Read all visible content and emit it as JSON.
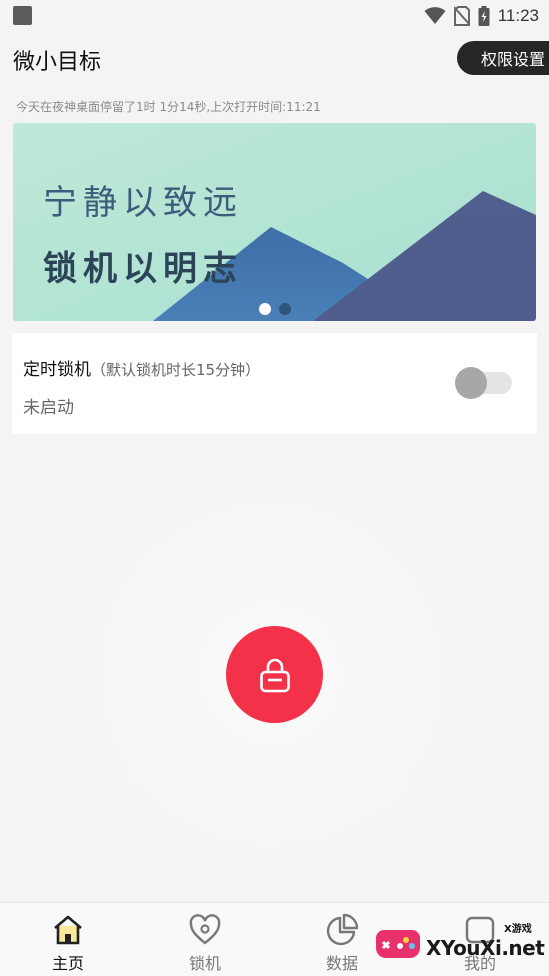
{
  "status_bar": {
    "time": "11:23",
    "icons": [
      "app-notification-icon",
      "wifi-icon",
      "no-sim-icon",
      "battery-charging-icon"
    ]
  },
  "header": {
    "title": "微小目标",
    "permission_button": "权限设置"
  },
  "usage_info": "今天在夜神桌面停留了1时 1分14秒,上次打开时间:11:21",
  "banner": {
    "line1": "宁静以致远",
    "line2": "锁机以明志",
    "slide_count": 2,
    "active_slide": 1
  },
  "timed_lock": {
    "title": "定时锁机",
    "note": "（默认锁机时长15分钟）",
    "status": "未启动",
    "enabled": false
  },
  "lock_button": {
    "icon": "padlock-icon",
    "color": "#f3324a"
  },
  "nav": {
    "items": [
      {
        "label": "主页",
        "icon": "home-icon",
        "active": true
      },
      {
        "label": "锁机",
        "icon": "heart-lock-icon",
        "active": false
      },
      {
        "label": "数据",
        "icon": "pie-chart-icon",
        "active": false
      },
      {
        "label": "我的",
        "icon": "profile-icon",
        "active": false
      }
    ]
  },
  "watermark": {
    "text": "XYouXi.net",
    "small": "X游戏"
  }
}
